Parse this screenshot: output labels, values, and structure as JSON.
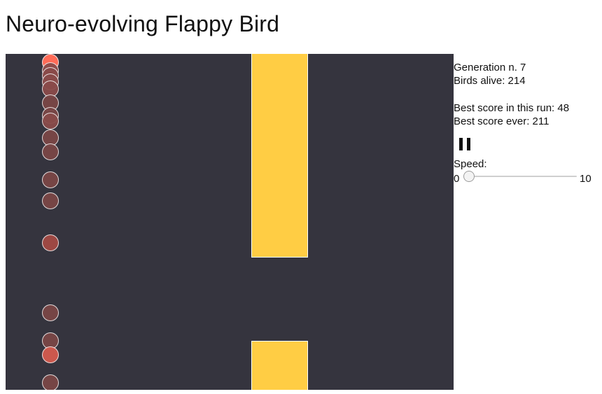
{
  "page": {
    "title": "Neuro-evolving Flappy Bird"
  },
  "stats": {
    "generation": "Generation n. 7",
    "birds_alive": "Birds alive: 214",
    "best_run": "Best score in this run: 48",
    "best_ever": "Best score ever: 211"
  },
  "controls": {
    "pause_icon": "pause-icon",
    "speed_label": "Speed:",
    "speed_min": "0",
    "speed_max": "10",
    "speed_value": 0
  },
  "colors": {
    "game_background": "#35343e",
    "pipe": "#ffcd44",
    "bird_active": "#ff6b57",
    "bird_faded": "#7a4a4a"
  }
}
